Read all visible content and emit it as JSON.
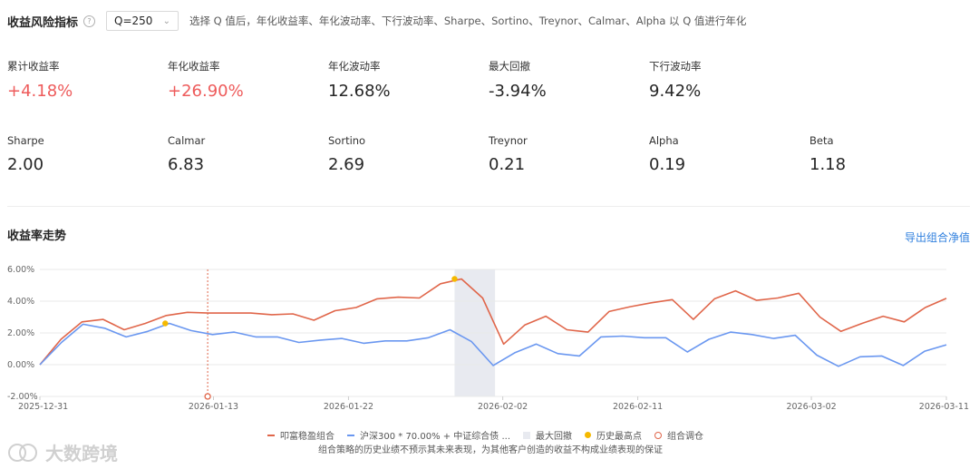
{
  "header": {
    "title": "收益风险指标",
    "help_glyph": "?",
    "q_value": "Q=250",
    "description": "选择 Q 值后，年化收益率、年化波动率、下行波动率、Sharpe、Sortino、Treynor、Calmar、Alpha 以 Q 值进行年化"
  },
  "metrics_row1": [
    {
      "label": "累计收益率",
      "value": "+4.18%",
      "positive": true
    },
    {
      "label": "年化收益率",
      "value": "+26.90%",
      "positive": true
    },
    {
      "label": "年化波动率",
      "value": "12.68%",
      "positive": false
    },
    {
      "label": "最大回撤",
      "value": "-3.94%",
      "positive": false
    },
    {
      "label": "下行波动率",
      "value": "9.42%",
      "positive": false
    }
  ],
  "metrics_row2": [
    {
      "label": "Sharpe",
      "value": "2.00"
    },
    {
      "label": "Calmar",
      "value": "6.83"
    },
    {
      "label": "Sortino",
      "value": "2.69"
    },
    {
      "label": "Treynor",
      "value": "0.21"
    },
    {
      "label": "Alpha",
      "value": "0.19"
    },
    {
      "label": "Beta",
      "value": "1.18"
    }
  ],
  "trend": {
    "title": "收益率走势",
    "export_label": "导出组合净值"
  },
  "legend": {
    "series1": "叩富稳盈组合",
    "series2": "沪深300 * 70.00% + 中证综合债 ...",
    "max_drawdown": "最大回撤",
    "peak": "历史最高点",
    "rebalance": "组合调仓"
  },
  "disclaimer": "组合策略的历史业绩不预示其未来表现，为其他客户创造的收益不构成业绩表现的保证",
  "watermark": "大数跨境",
  "colors": {
    "portfolio": "#e0664a",
    "benchmark": "#6a97f0",
    "positive": "#ee5b5b",
    "drawdown_shade": "#e8eaf0",
    "peak": "#f5b900",
    "link": "#2f7fde"
  },
  "chart_data": {
    "type": "line",
    "ylim": [
      -2.0,
      6.0
    ],
    "y_ticks": [
      "-2.00%",
      "0.00%",
      "2.00%",
      "4.00%",
      "6.00%"
    ],
    "x_tick_labels": [
      "2025-12-31",
      "2026-01-13",
      "2026-01-22",
      "2026-02-02",
      "2026-02-11",
      "2026-03-02",
      "2026-03-11"
    ],
    "x_tick_positions": [
      0,
      9,
      16,
      24,
      31,
      40,
      47
    ],
    "series": [
      {
        "name": "叩富稳盈组合",
        "values": [
          0.0,
          1.6,
          2.7,
          2.85,
          2.2,
          2.6,
          3.1,
          3.3,
          3.25,
          3.25,
          3.25,
          3.15,
          3.2,
          2.8,
          3.4,
          3.6,
          4.15,
          4.25,
          4.2,
          5.1,
          5.4,
          4.2,
          1.3,
          2.5,
          3.05,
          2.2,
          2.05,
          3.35,
          3.65,
          3.9,
          4.1,
          2.85,
          4.15,
          4.65,
          4.05,
          4.2,
          4.5,
          3.0,
          2.1,
          2.6,
          3.05,
          2.7,
          3.6,
          4.18
        ]
      },
      {
        "name": "沪深300 * 70.00% + 中证综合债 ...",
        "values": [
          0.0,
          1.4,
          2.55,
          2.3,
          1.75,
          2.1,
          2.6,
          2.15,
          1.9,
          2.05,
          1.75,
          1.75,
          1.4,
          1.55,
          1.65,
          1.35,
          1.5,
          1.5,
          1.7,
          2.2,
          1.45,
          -0.05,
          0.75,
          1.3,
          0.7,
          0.55,
          1.75,
          1.8,
          1.7,
          1.7,
          0.8,
          1.6,
          2.05,
          1.9,
          1.65,
          1.85,
          0.6,
          -0.1,
          0.5,
          0.55,
          -0.05,
          0.85,
          1.25
        ]
      }
    ],
    "max_drawdown_range": [
      "2026-01-30",
      "2026-02-02"
    ],
    "peak_markers": [
      {
        "x": "2026-01-09",
        "y": 2.6
      },
      {
        "x": "2026-01-30",
        "y": 5.4
      }
    ],
    "rebalance_markers": [
      {
        "x": "2026-01-13",
        "y": -2.0
      }
    ]
  }
}
